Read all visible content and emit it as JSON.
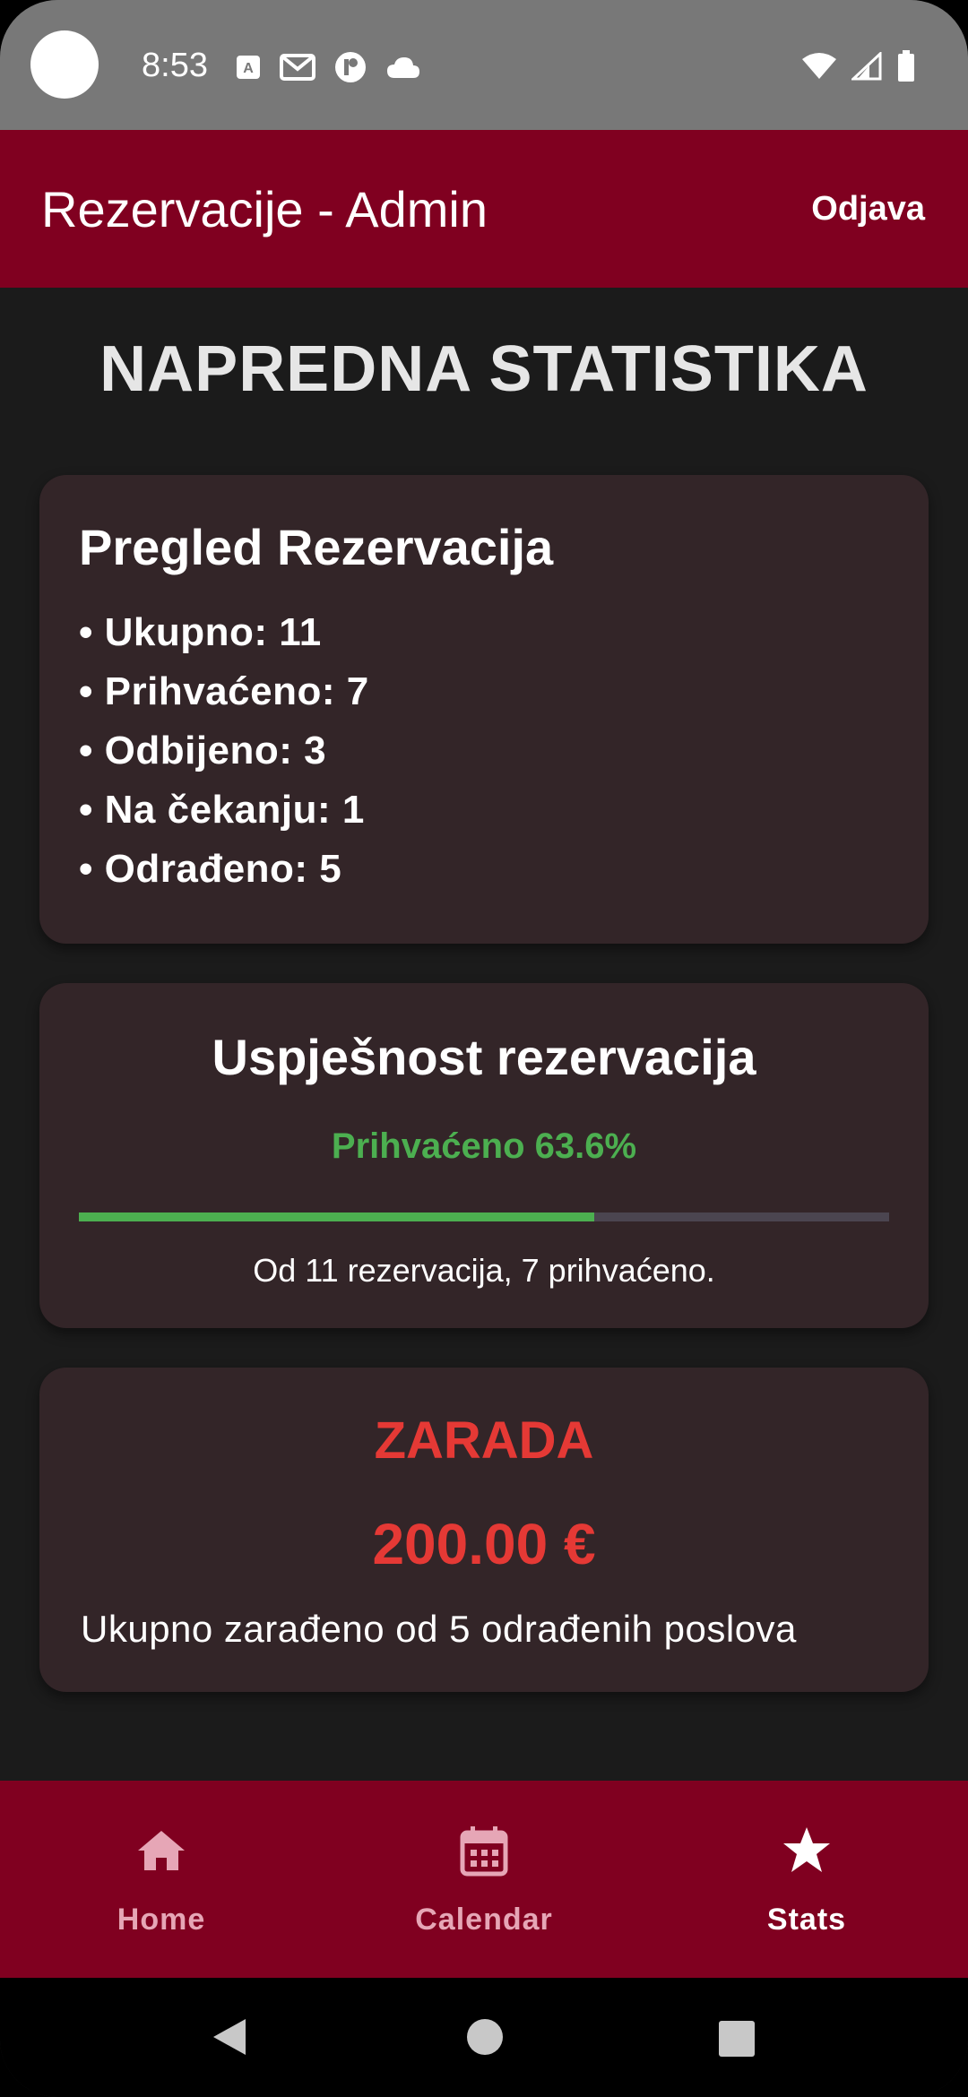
{
  "status_bar": {
    "time": "8:53",
    "notification_icons": [
      "translate-icon",
      "gmail-icon",
      "app-icon",
      "cloud-icon"
    ],
    "system_icons": [
      "wifi-icon",
      "signal-icon",
      "battery-icon"
    ]
  },
  "app_bar": {
    "title": "Rezervacije - Admin",
    "logout_label": "Odjava",
    "color": "#800020"
  },
  "page": {
    "heading": "NAPREDNA STATISTIKA"
  },
  "overview": {
    "title": "Pregled Rezervacija",
    "items": [
      "• Ukupno: 11",
      "• Prihvaćeno: 7",
      "• Odbijeno: 3",
      "• Na čekanju: 1",
      "• Odrađeno: 5"
    ]
  },
  "success": {
    "title": "Uspješnost rezervacija",
    "percent_text": "Prihvaćeno 63.6%",
    "progress": 0.636,
    "caption": "Od 11 rezervacija, 7 prihvaćeno.",
    "color": "#4caf50"
  },
  "earnings": {
    "title": "ZARADA",
    "amount": "200.00 €",
    "caption": "Ukupno zarađeno od 5 odrađenih poslova",
    "color": "#e53935"
  },
  "bottom_nav": {
    "items": [
      {
        "label": "Home",
        "icon": "home-icon",
        "active": false
      },
      {
        "label": "Calendar",
        "icon": "calendar-icon",
        "active": false
      },
      {
        "label": "Stats",
        "icon": "star-icon",
        "active": true
      }
    ]
  },
  "system_nav": {
    "buttons": [
      "back-icon",
      "home-circle-icon",
      "recents-icon"
    ]
  }
}
